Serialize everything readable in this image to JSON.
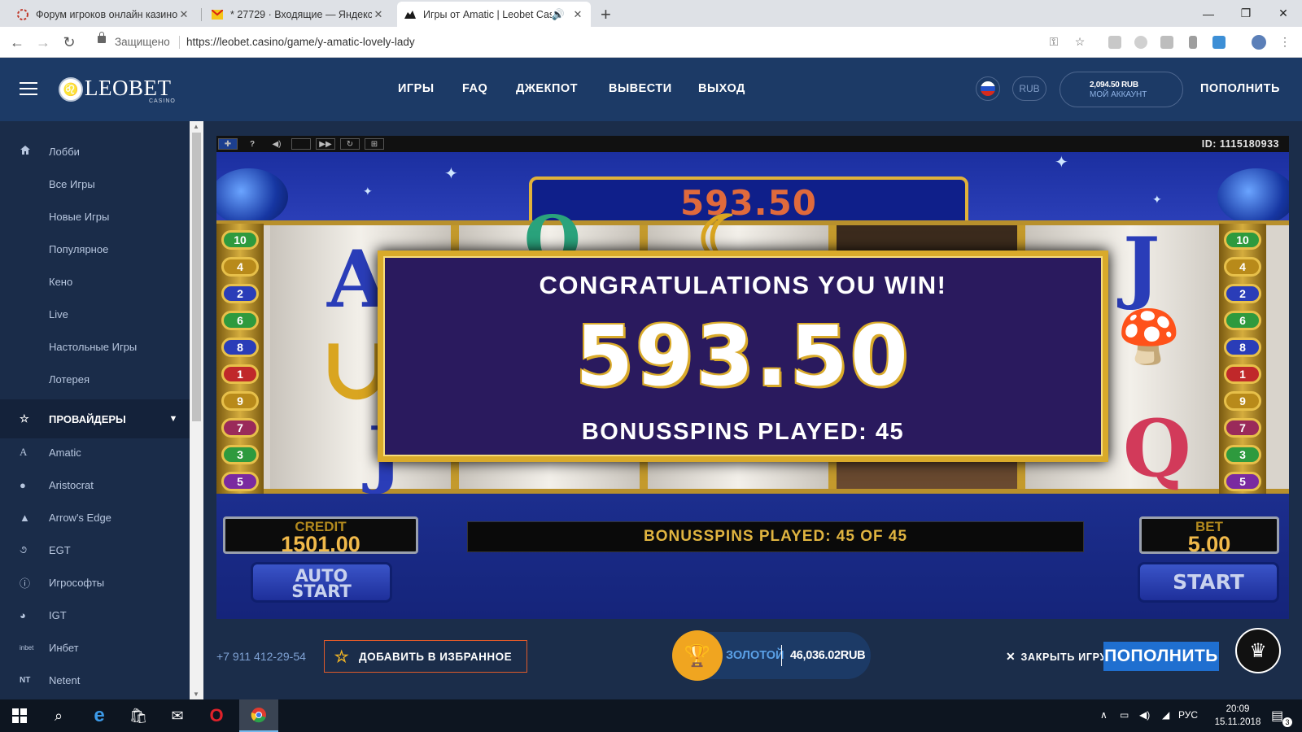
{
  "browser": {
    "tabs": [
      {
        "title": "Форум игроков онлайн казино",
        "icon": "forum-favicon-icon"
      },
      {
        "title": "* 27729 · Входящие — Яндекс.П",
        "icon": "yandex-mail-favicon-icon"
      },
      {
        "title": "Игры от Amatic | Leobet Cas",
        "icon": "leobet-favicon-icon",
        "active": true,
        "audio": true
      }
    ],
    "secure_label": "Защищено",
    "url": "https://leobet.casino/game/y-amatic-lovely-lady"
  },
  "header": {
    "logo_text": "LEOBET",
    "logo_sub": "CASINO",
    "nav": [
      "ИГРЫ",
      "FAQ",
      "ДЖЕКПОТ",
      "ВЫВЕСТИ",
      "ВЫХОД"
    ],
    "currency": "RUB",
    "balance": "2,094.50 RUB",
    "account_label": "МОЙ АККАУНТ",
    "deposit": "ПОПОЛНИТЬ"
  },
  "sidebar": {
    "items": [
      {
        "label": "Лобби",
        "icon": "home-icon"
      },
      {
        "label": "Все Игры"
      },
      {
        "label": "Новые Игры"
      },
      {
        "label": "Популярное"
      },
      {
        "label": "Кено"
      },
      {
        "label": "Live"
      },
      {
        "label": "Настольные Игры"
      },
      {
        "label": "Лотерея"
      }
    ],
    "providers_label": "ПРОВАЙДЕРЫ",
    "providers": [
      {
        "label": "Amatic",
        "icon": "amatic-icon"
      },
      {
        "label": "Aristocrat",
        "icon": "aristocrat-icon"
      },
      {
        "label": "Arrow's Edge",
        "icon": "arrows-edge-icon"
      },
      {
        "label": "EGT",
        "icon": "egt-icon"
      },
      {
        "label": "Игрософты",
        "icon": "igrosoft-icon"
      },
      {
        "label": "IGT",
        "icon": "igt-icon"
      },
      {
        "label": "Инбет",
        "icon": "inbet-icon"
      },
      {
        "label": "Netent",
        "icon": "netent-icon"
      }
    ]
  },
  "game": {
    "id_label": "ID: 1115180933",
    "top_win": "593.50",
    "win_title": "CONGRATULATIONS YOU WIN!",
    "win_amount": "593.50",
    "win_bonus": "BONUSSPINS PLAYED: 45",
    "paylines": [
      "10",
      "4",
      "2",
      "6",
      "8",
      "1",
      "9",
      "7",
      "3",
      "5"
    ],
    "credit_label": "CREDIT",
    "credit_value": "1501.00",
    "bonus_status": "BONUSSPINS PLAYED: 45 OF 45",
    "bet_label": "BET",
    "bet_value": "5.00",
    "auto_start_line1": "AUTO",
    "auto_start_line2": "START",
    "start_label": "START"
  },
  "footer_bar": {
    "phone": "+7 911 412-29-54",
    "favorite": "ДОБАВИТЬ В ИЗБРАННОЕ",
    "loyalty_level": "ЗОЛОТОЙ",
    "loyalty_balance": "46,036.02RUB",
    "close_game": "ЗАКРЫТЬ ИГРУ",
    "deposit": "ПОПОЛНИТЬ"
  },
  "taskbar": {
    "lang": "РУС",
    "time": "20:09",
    "date": "15.11.2018",
    "notifications": "3"
  },
  "colors": {
    "header_bg": "#1c3a66",
    "sidebar_bg": "#1a2c49",
    "accent_gold": "#d9aa2a",
    "deposit_blue": "#1f6fd0"
  }
}
